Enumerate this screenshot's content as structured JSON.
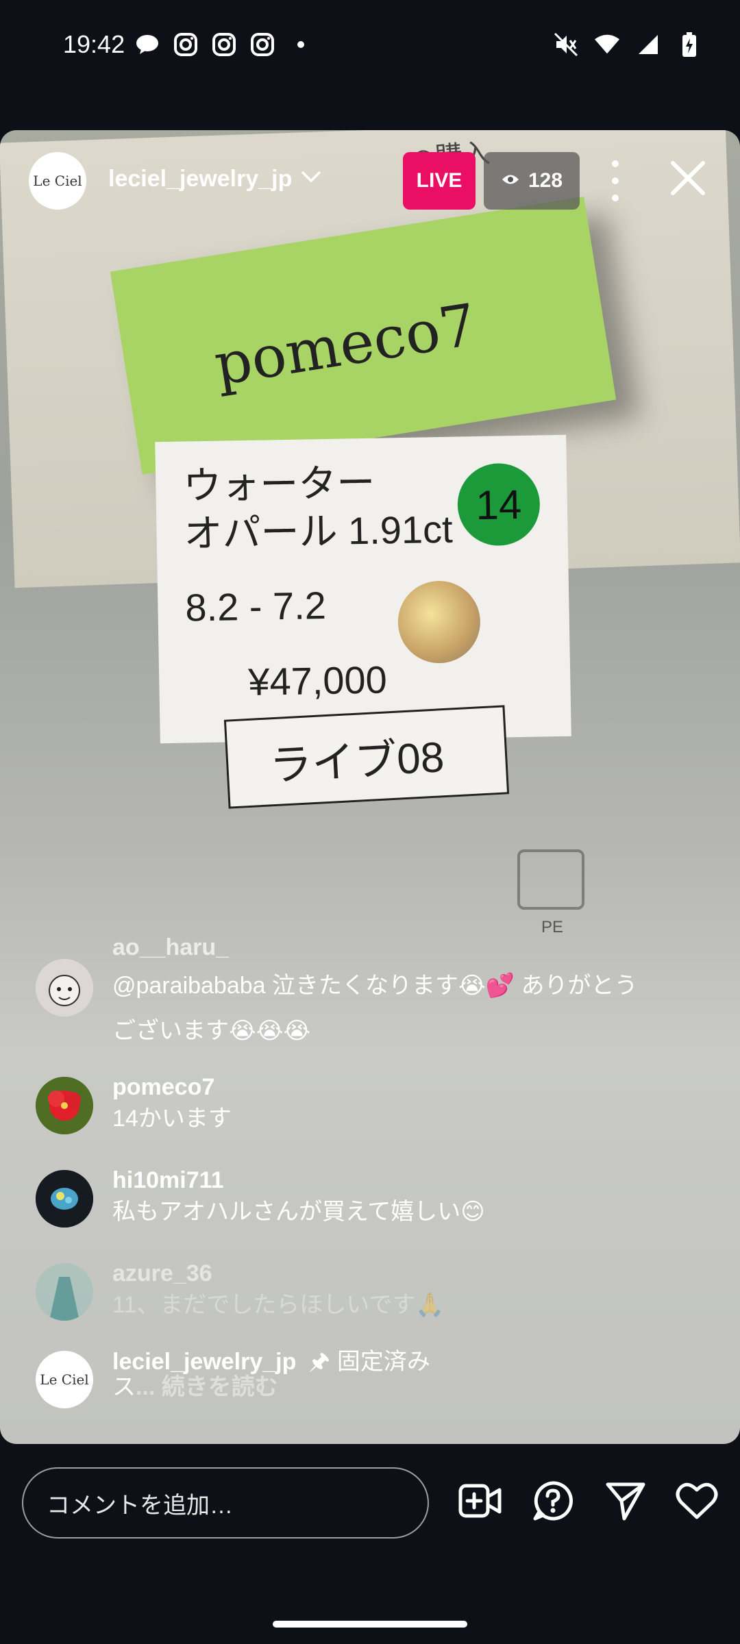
{
  "status_bar": {
    "time": "19:42",
    "left_icons": [
      "chat-bubble-icon",
      "instagram-icon",
      "instagram-icon",
      "instagram-icon",
      "dot-icon"
    ],
    "right_icons": [
      "mute-icon",
      "wifi-icon",
      "signal-icon",
      "battery-charging-icon"
    ]
  },
  "header": {
    "avatar_text": "Le Ciel",
    "username": "leciel_jewelry_jp",
    "live_label": "LIVE",
    "viewer_count": "128"
  },
  "video": {
    "paper_text": "◎購入",
    "sticky_text": "pomeco7",
    "card_line1": "ウォーター",
    "card_line2": "オパール 1.91ct",
    "card_number": "14",
    "card_line3": "8.2 - 7.2",
    "card_price": "¥47,000",
    "live_tag": "ライブ08",
    "pe_text": "PE"
  },
  "comments": [
    {
      "user": "ao__haru_",
      "text": "@paraibababa 泣きたくなります😭💕 ありがとうございます😭😭😭",
      "faded": false
    },
    {
      "user": "pomeco7",
      "text": "14かいます",
      "faded": false
    },
    {
      "user": "hi10mi711",
      "text": "私もアオハルさんが買えて嬉しい😊",
      "faded": false
    },
    {
      "user": "azure_36",
      "text": "11、まだでしたらほしいです🙏",
      "faded": true
    },
    {
      "user": "leciel_jewelry_jp",
      "pinned_label": "固定済み",
      "text_prefix": "ス",
      "read_more": "... 続きを読む",
      "avatar_text": "Le Ciel"
    }
  ],
  "bottom_bar": {
    "comment_placeholder": "コメントを追加…",
    "icons": [
      "add-video-icon",
      "question-icon",
      "send-icon",
      "heart-icon"
    ]
  },
  "colors": {
    "background": "#0d1117",
    "live_badge": "#ea0e65",
    "viewer_badge": "#5a5a5a"
  }
}
